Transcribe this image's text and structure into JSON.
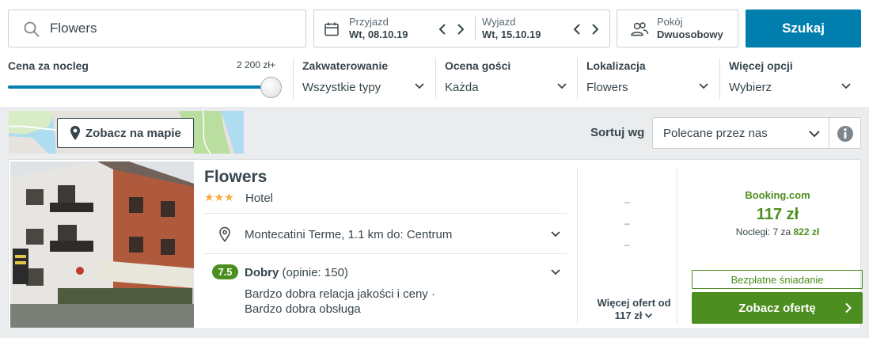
{
  "search": {
    "query": "Flowers"
  },
  "dates": {
    "checkin_label": "Przyjazd",
    "checkin_value": "Wt, 08.10.19",
    "checkout_label": "Wyjazd",
    "checkout_value": "Wt, 15.10.19"
  },
  "room": {
    "label": "Pokój",
    "value": "Dwuosobowy"
  },
  "search_button": "Szukaj",
  "filters": {
    "price_label": "Cena za nocleg",
    "price_max": "2 200 zł+",
    "price_slider_fraction": 1.0,
    "accommodation": {
      "title": "Zakwaterowanie",
      "value": "Wszystkie typy"
    },
    "rating": {
      "title": "Ocena gości",
      "value": "Każda"
    },
    "location": {
      "title": "Lokalizacja",
      "value": "Flowers"
    },
    "more": {
      "title": "Więcej opcji",
      "value": "Wybierz"
    }
  },
  "map_button": "Zobacz na mapie",
  "sort": {
    "label": "Sortuj wg",
    "value": "Polecane przez nas"
  },
  "hotel": {
    "name": "Flowers",
    "stars": 3,
    "stars_text": "★★★",
    "type": "Hotel",
    "location": "Montecatini Terme, 1.1 km do: Centrum",
    "rating_score": "7.5",
    "rating_word": "Dobry",
    "rating_count": "(opinie: 150)",
    "review_line1": "Bardzo dobra relacja jakości i ceny ·",
    "review_line2": "Bardzo dobra obsługa",
    "dashes": [
      "–",
      "–",
      "–"
    ],
    "more_offers_line1": "Więcej ofert od",
    "more_offers_line2": "117 zł",
    "provider": "Booking.com",
    "price": "117 zł",
    "nights_text": "Noclegi: 7 za",
    "nights_total": "822 zł",
    "breakfast": "Bezpłatne śniadanie",
    "offer_button": "Zobacz ofertę"
  },
  "colors": {
    "primary": "#007faf",
    "green": "#4c8e1f",
    "star": "#f6ab3f",
    "text": "#37454d"
  }
}
